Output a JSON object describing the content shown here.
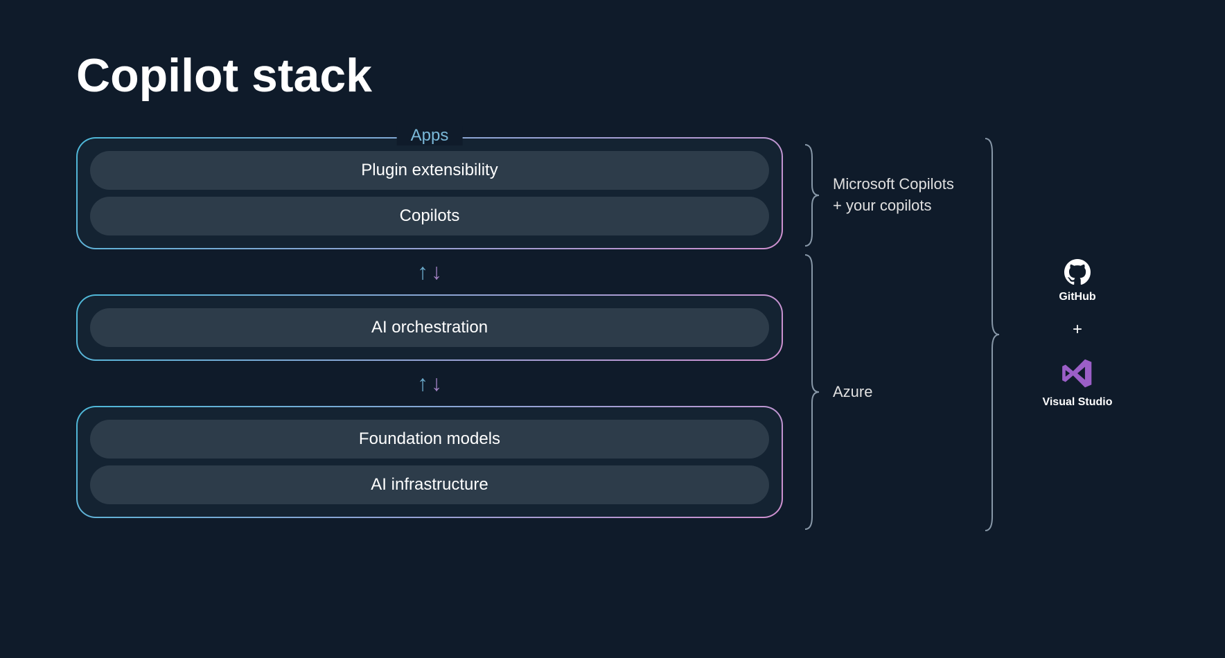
{
  "title": "Copilot stack",
  "groups": {
    "apps": {
      "label": "Apps",
      "items": [
        "Plugin extensibility",
        "Copilots"
      ]
    },
    "orchestration": {
      "items": [
        "AI orchestration"
      ]
    },
    "foundation": {
      "items": [
        "Foundation models",
        "AI infrastructure"
      ]
    }
  },
  "brackets": {
    "top": {
      "line1": "Microsoft Copilots",
      "line2": "+ your copilots"
    },
    "bottom": {
      "label": "Azure"
    }
  },
  "tools": {
    "github": "GitHub",
    "plus": "+",
    "visualstudio": "Visual Studio"
  }
}
